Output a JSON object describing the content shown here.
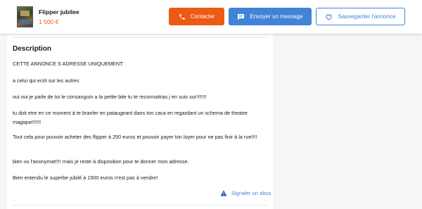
{
  "listing": {
    "title": "Flipper jubilee",
    "price": "1 500 €"
  },
  "actions": {
    "contact_label": "Contacter",
    "message_label": "Envoyer un message",
    "save_label": "Sauvegarder l'annonce"
  },
  "description": {
    "heading": "Description",
    "paragraphs": [
      "CETTE ANNONCE S ADRESSE UNIQUEMENT:",
      "a celui qui ecrit sur les autres",
      "oui oui je parle de toi le consanguin a la petite bite tu te reconnaitras j en suis sur!!!!!!!",
      "tu doit etre en ce moment à te branler en pataugeant dans ton caca en regardant un schema de theatre magique!!!!!!",
      "Tout cela pour pouvoir acheter des flipper à 250 euros et pouvoir payer ton loyer pour ne pas finir à la rue!!!!",
      "bien vu l'anonymat!!!! mais je reste à disposition pour te donner mon adresse.",
      "Bien entendu le superbe jubilé à 1500 euros n'est pas à vendre!"
    ]
  },
  "report_label": "Signaler un abus",
  "icons": {
    "phone": "phone-icon",
    "message": "message-bubble-icon",
    "save": "heart-icon",
    "report": "warning-icon"
  },
  "colors": {
    "orange": "#ec5a13",
    "blue": "#4183d7"
  }
}
